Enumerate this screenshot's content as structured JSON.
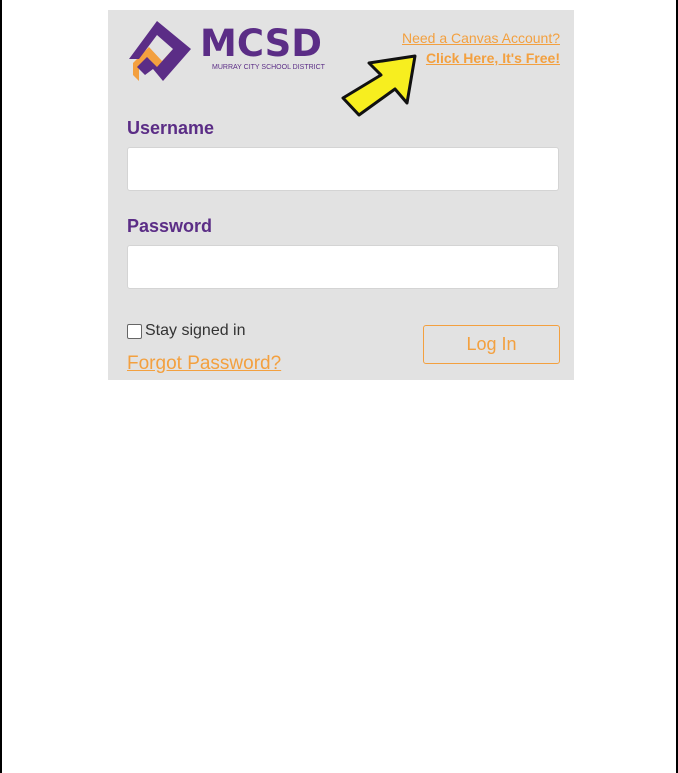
{
  "logo": {
    "name": "MCSD",
    "subtitle": "MURRAY CITY SCHOOL DISTRICT",
    "icon": "mcsd-m-logo-icon"
  },
  "account_links": {
    "need_account": "Need a Canvas Account?",
    "click_here": "Click Here, It's Free!"
  },
  "annotation": {
    "icon": "yellow-arrow-icon",
    "color": "#f7ee1f"
  },
  "form": {
    "username_label": "Username",
    "username_value": "",
    "password_label": "Password",
    "password_value": "",
    "stay_signed_in_label": "Stay signed in",
    "stay_signed_in_checked": false,
    "forgot_password": "Forgot Password?",
    "login_button": "Log In"
  },
  "colors": {
    "brand_purple": "#5b2d86",
    "accent_orange": "#f3a03f",
    "panel_bg": "#e2e2e2"
  }
}
